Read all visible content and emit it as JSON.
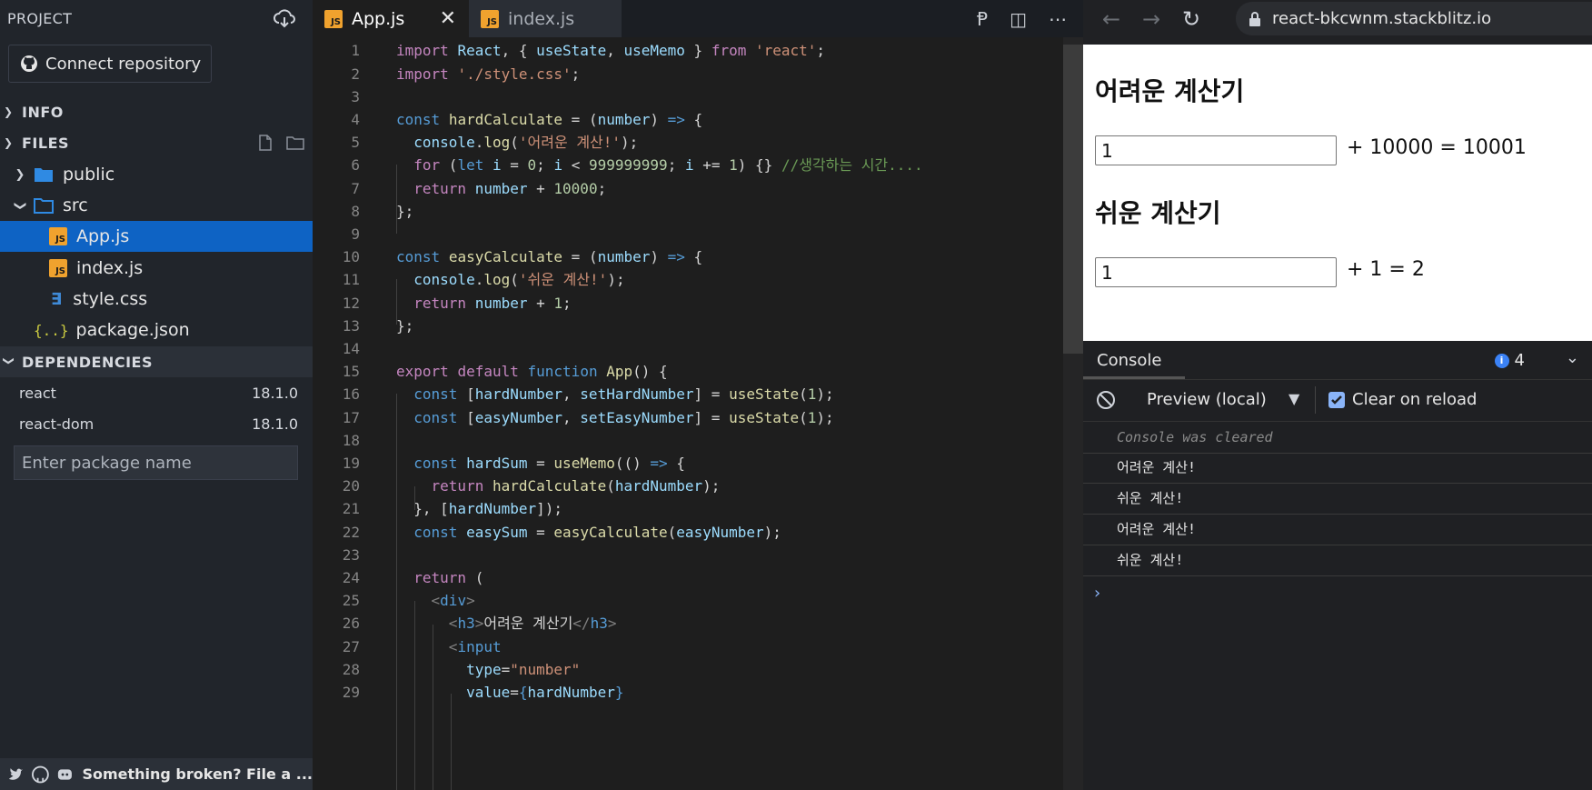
{
  "sidebar": {
    "title": "PROJECT",
    "connect_label": "Connect repository",
    "sections": {
      "info": "INFO",
      "files": "FILES",
      "dependencies": "DEPENDENCIES"
    },
    "tree": [
      {
        "label": "public",
        "kind": "folder"
      },
      {
        "label": "src",
        "kind": "folder"
      },
      {
        "label": "App.js",
        "kind": "js"
      },
      {
        "label": "index.js",
        "kind": "js"
      },
      {
        "label": "style.css",
        "kind": "css"
      },
      {
        "label": "package.json",
        "kind": "json"
      }
    ],
    "dependencies": [
      {
        "name": "react",
        "version": "18.1.0"
      },
      {
        "name": "react-dom",
        "version": "18.1.0"
      }
    ],
    "package_placeholder": "Enter package name",
    "footer_text": "Something broken? File a ..."
  },
  "tabs": [
    {
      "label": "App.js",
      "active": true
    },
    {
      "label": "index.js",
      "active": false
    }
  ],
  "editor": {
    "line_numbers": [
      "1",
      "2",
      "3",
      "4",
      "5",
      "6",
      "7",
      "8",
      "9",
      "10",
      "11",
      "12",
      "13",
      "14",
      "15",
      "16",
      "17",
      "18",
      "19",
      "20",
      "21",
      "22",
      "23",
      "24",
      "25",
      "26",
      "27",
      "28",
      "29"
    ]
  },
  "browser": {
    "url": "react-bkcwnm.stackblitz.io",
    "preview": {
      "hard_title": "어려운 계산기",
      "hard_value": "1",
      "hard_result": "+ 10000 = 10001",
      "easy_title": "쉬운 계산기",
      "easy_value": "1",
      "easy_result": "+ 1 = 2"
    },
    "console": {
      "tab_label": "Console",
      "message_count": "4",
      "source": "Preview (local)",
      "clear_on_reload": "Clear on reload",
      "entries": [
        "Console was cleared",
        "어려운 계산!",
        "쉬운 계산!",
        "어려운 계산!",
        "쉬운 계산!"
      ]
    }
  },
  "colors": {
    "accent": "#0e63c4",
    "js_icon": "#f0a22e"
  }
}
